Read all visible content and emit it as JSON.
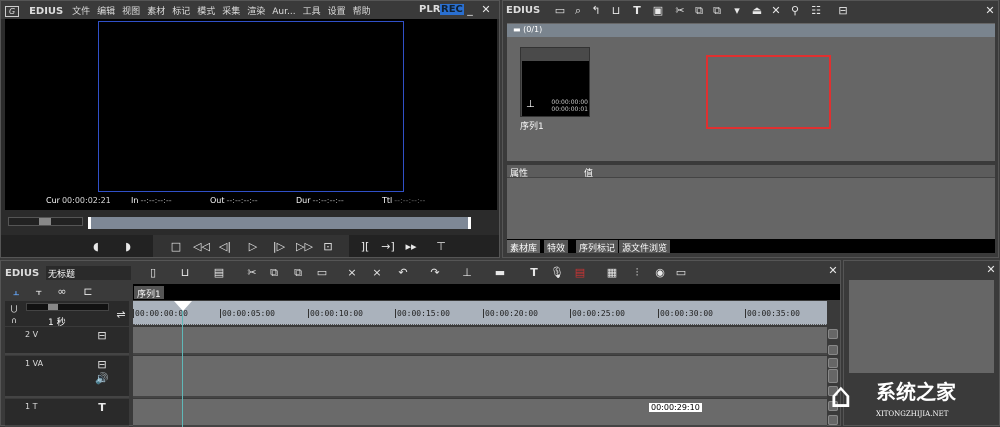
{
  "player": {
    "app": "EDIUS",
    "menu": [
      "文件",
      "编辑",
      "视图",
      "素材",
      "标记",
      "模式",
      "采集",
      "渲染",
      "Aur...",
      "工具",
      "设置",
      "帮助"
    ],
    "plr": "PLR",
    "rec": "REC",
    "timecodes": [
      {
        "label": "Cur",
        "value": "00:00:02:21"
      },
      {
        "label": "In",
        "value": "--:--:--:--"
      },
      {
        "label": "Out",
        "value": "--:--:--:--"
      },
      {
        "label": "Dur",
        "value": "--:--:--:--"
      },
      {
        "label": "Ttl",
        "value": "--:--:--:--"
      }
    ]
  },
  "bin": {
    "app": "EDIUS",
    "folder": "(0/1)",
    "clip": {
      "name": "序列1",
      "tc_in": "00:00:00:00",
      "tc_out": "00:00:00:01"
    },
    "props_headers": [
      "属性",
      "值"
    ],
    "tabs": [
      "素材库",
      "特效",
      "序列标记",
      "源文件浏览"
    ],
    "highlight_color": "#e03030"
  },
  "timeline": {
    "app": "EDIUS",
    "project": "无标题",
    "sequence_tab": "序列1",
    "scale": "1 秒",
    "ruler": [
      "00:00:00:00",
      "00:00:05:00",
      "00:00:10:00",
      "00:00:15:00",
      "00:00:20:00",
      "00:00:25:00",
      "00:00:30:00",
      "00:00:35:00"
    ],
    "tracks": [
      {
        "name": "2 V"
      },
      {
        "name": "1 VA"
      },
      {
        "name": "1 T"
      }
    ],
    "tooltip": "00:00:29:10",
    "playhead_color": "#5fb8b8"
  },
  "watermark": {
    "text": "系统之家",
    "url": "XITONGZHIJIA.NET"
  }
}
